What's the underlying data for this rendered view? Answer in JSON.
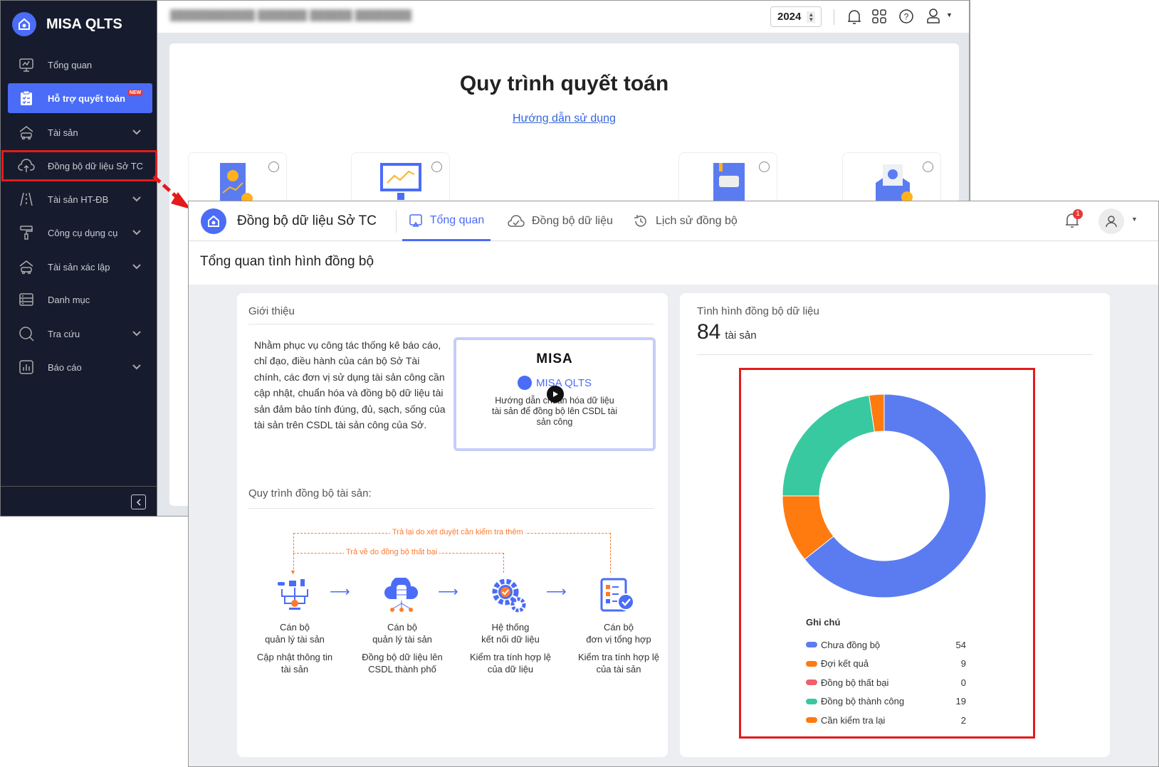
{
  "sidebar": {
    "brand": "MISA QLTS",
    "items": [
      {
        "label": "Tổng quan"
      },
      {
        "label": "Hỗ trợ quyết toán",
        "badge": "NEW"
      },
      {
        "label": "Tài sản"
      },
      {
        "label": "Đồng bộ dữ liệu Sở TC"
      },
      {
        "label": "Tài sản HT-ĐB"
      },
      {
        "label": "Công cụ dụng cụ"
      },
      {
        "label": "Tài sản xác lập"
      },
      {
        "label": "Danh mục"
      },
      {
        "label": "Tra cứu"
      },
      {
        "label": "Báo cáo"
      }
    ]
  },
  "bg_window": {
    "year": "2024",
    "title": "Quy trình quyết toán",
    "link": "Hướng dẫn sử dụng"
  },
  "overlay": {
    "module_title": "Đồng bộ dữ liệu Sở TC",
    "tabs": [
      {
        "label": "Tổng quan"
      },
      {
        "label": "Đồng bộ dữ liệu"
      },
      {
        "label": "Lịch sử đồng bộ"
      }
    ],
    "notif_count": "1",
    "page_title": "Tổng quan tình hình đồng bộ"
  },
  "intro": {
    "title": "Giới thiệu",
    "text": "Nhằm phục vụ công tác thống kê báo cáo, chỉ đạo, điều hành của cán bộ Sở Tài chính, các đơn vị sử dụng tài sản công cần cập nhật, chuẩn hóa và đồng bộ dữ liệu tài sản đảm bảo tính đúng, đủ, sạch, sống của tài sản trên CSDL tài sản công của Sở.",
    "video_brand": "MISA",
    "video_product": "MISA QLTS",
    "video_caption": "Hướng dẫn chuẩn hóa dữ liệu tài sản để đồng bộ lên CSDL tài sản công"
  },
  "process": {
    "title": "Quy trình đồng bộ tài sản:",
    "loop_outer": "Trả lại do xét duyệt cần kiểm tra thêm",
    "loop_inner": "Trả về do đồng bộ thất bại",
    "steps": [
      {
        "actor": "Cán bộ\nquản lý tài sản",
        "action": "Cập nhật thông tin tài sản"
      },
      {
        "actor": "Cán bộ\nquản lý tài sản",
        "action": "Đồng bộ dữ liệu lên CSDL thành phố"
      },
      {
        "actor": "Hệ thống\nkết nối dữ liệu",
        "action": "Kiểm tra tính hợp lệ của dữ liệu"
      },
      {
        "actor": "Cán bộ\nđơn vị tổng hợp",
        "action": "Kiểm tra tính hợp lệ của tài sản"
      }
    ]
  },
  "status": {
    "title": "Tình hình đồng bộ dữ liệu",
    "total": "84",
    "unit": "tài sản",
    "legend_title": "Ghi chú"
  },
  "chart_data": {
    "type": "pie",
    "donut": true,
    "title": "Tình hình đồng bộ dữ liệu",
    "categories": [
      "Chưa đồng bộ",
      "Đợi kết quả",
      "Đồng bộ thất bại",
      "Đồng bộ thành công",
      "Cần kiểm tra lại"
    ],
    "values": [
      54,
      9,
      0,
      19,
      2
    ],
    "colors": [
      "#5b7cf0",
      "#ff7a0f",
      "#f0606a",
      "#38c9a0",
      "#ff7a0f"
    ],
    "legend": "bottom"
  }
}
